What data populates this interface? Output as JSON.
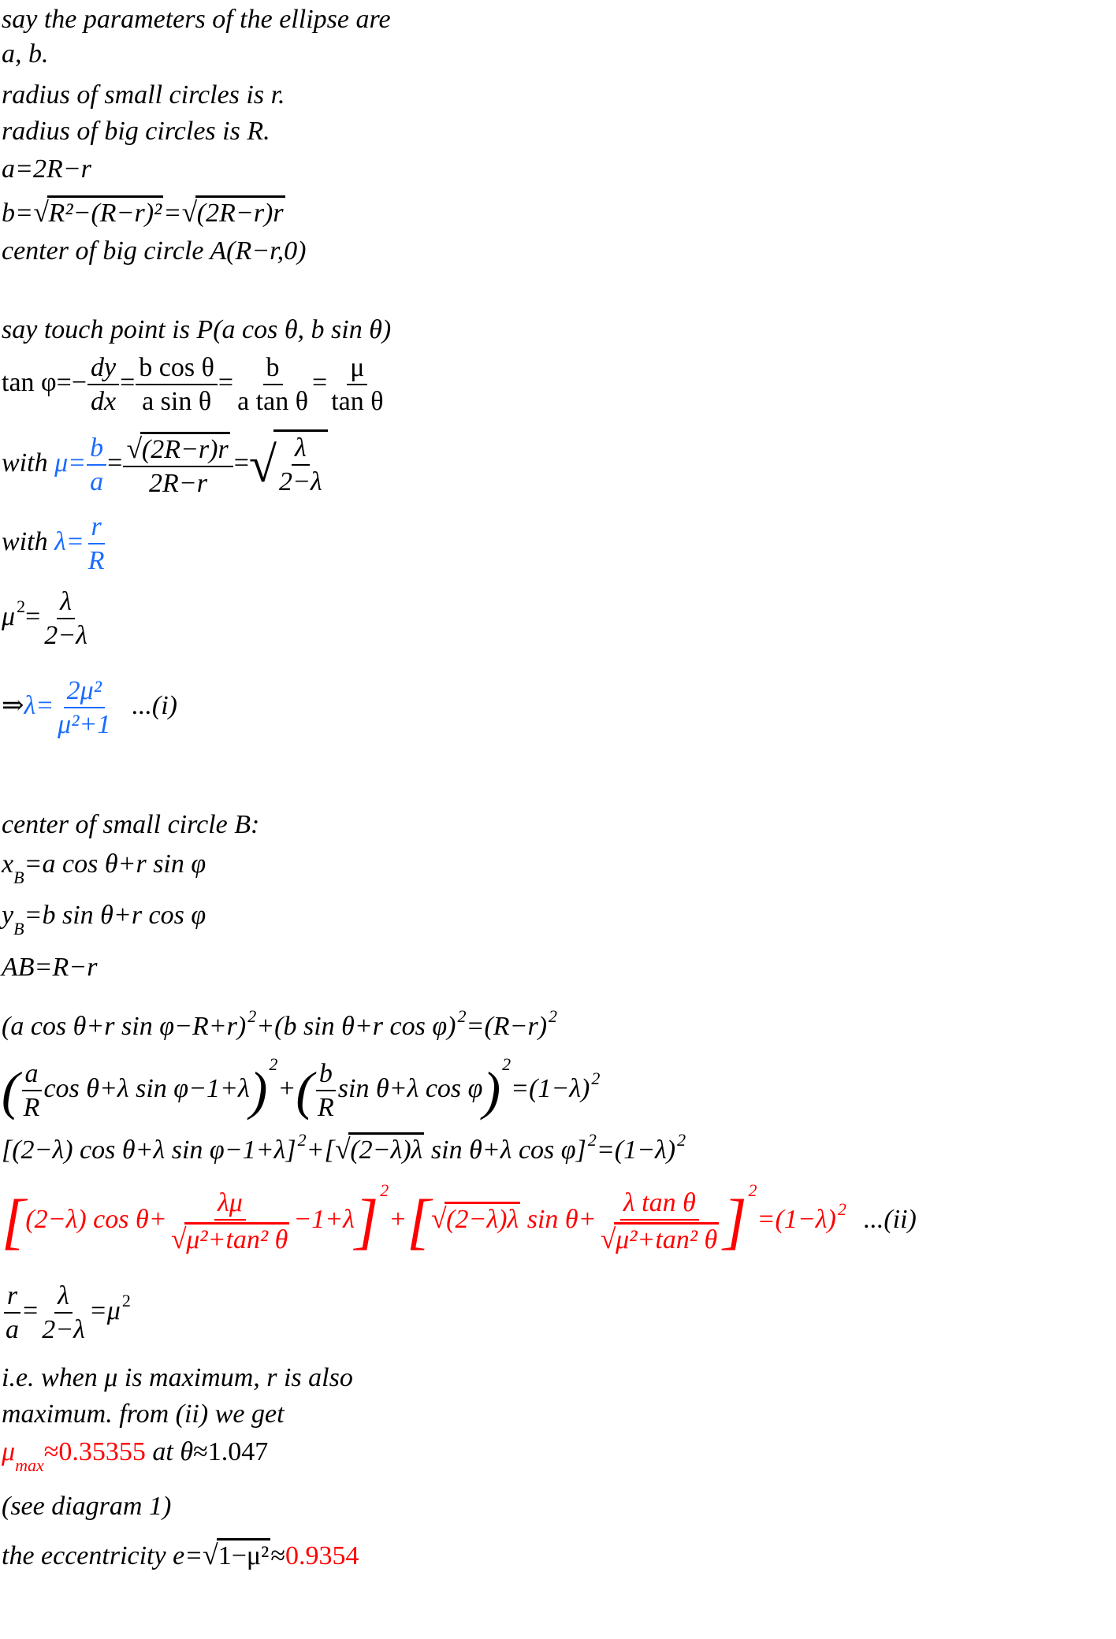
{
  "colors": {
    "text": "#000000",
    "highlight_blue": "#1a6cff",
    "highlight_red": "#ff0000",
    "background": "#ffffff"
  },
  "lines": {
    "l1": "say the parameters of the ellipse are",
    "l2": "a, b.",
    "l3": "radius of small circles is r.",
    "l4": "radius of big circles is R.",
    "l5": "a=2R−r",
    "l6": {
      "lhs": "b=",
      "rad1": "R²−(R−r)²",
      "eq": "=",
      "rad2": "(2R−r)r"
    },
    "l7": "center of big circle A(R−r,0)",
    "l8": "say touch point is P(a cos θ, b sin θ)",
    "l9": {
      "lhs": "tan φ=−",
      "f1n": "dy",
      "f1d": "dx",
      "f2n": "b cos θ",
      "f2d": "a sin θ",
      "f3n": "b",
      "f3d": "a tan θ",
      "f4n": "μ",
      "f4d": "tan θ"
    },
    "l10": {
      "prefix": "with ",
      "mu_eq": "μ=",
      "f1n": "b",
      "f1d": "a",
      "f2n": "(2R−r)r",
      "f2d": "2R−r",
      "f3n": "λ",
      "f3d": "2−λ"
    },
    "l11": {
      "prefix": "with ",
      "lam_eq": "λ=",
      "fn": "r",
      "fd": "R"
    },
    "l12": {
      "lhs": "μ",
      "exp": "2",
      "eq": "=",
      "fn": "λ",
      "fd": "2−λ"
    },
    "l13": {
      "arrow": "⇒",
      "lam_eq": "λ=",
      "fn": "2μ²",
      "fd": "μ²+1",
      "tag": "...(i)"
    },
    "l14": "center of small circle B:",
    "l15": {
      "var": "x",
      "sub": "B",
      "rhs": "=a cos θ+r sin φ"
    },
    "l16": {
      "var": "y",
      "sub": "B",
      "rhs": "=b sin θ+r cos φ"
    },
    "l17": "AB=R−r",
    "l18": {
      "t1": "(a cos θ+r sin φ−R+r)",
      "t2": "+(b sin θ+r cos φ)",
      "t3": "=(R−r)",
      "exp": "2"
    },
    "l19": {
      "f1n": "a",
      "f1d": "R",
      "t1": "cos θ+λ sin φ−1+λ",
      "plus": "+",
      "f2n": "b",
      "f2d": "R",
      "t2": "sin θ+λ cos φ",
      "rhs": "=(1−λ)",
      "exp": "2"
    },
    "l20": {
      "t1": "[(2−λ) cos θ+λ sin φ−1+λ]",
      "t2": "+[",
      "rad": "(2−λ)λ",
      "t3": " sin θ+λ cos φ]",
      "rhs": "=(1−λ)",
      "exp": "2"
    },
    "l21": {
      "t1": "(2−λ) cos θ+",
      "f1n": "λμ",
      "f1d": "μ²+tan² θ",
      "t2": "−1+λ",
      "plus": "+",
      "rad": "(2−λ)λ",
      "t3": " sin θ+",
      "f2n": "λ tan θ",
      "f2d": "μ²+tan² θ",
      "rhs": "=(1−λ)",
      "exp": "2",
      "tag": "...(ii)"
    },
    "l22": {
      "f1n": "r",
      "f1d": "a",
      "eq1": "=",
      "f2n": "λ",
      "f2d": "2−λ",
      "eq2": "=μ",
      "exp": "2"
    },
    "l23": "i.e. when μ is maximum, r is also",
    "l24": "maximum. from (ii) we get",
    "l25": {
      "mu": "μ",
      "sub": "max",
      "val": "≈0.35355",
      "mid": " at θ",
      "theta_val": "≈1.047"
    },
    "l26": "(see diagram 1)",
    "l27": {
      "prefix": "the eccentricity e=",
      "rad": "1−μ²",
      "approx": "≈",
      "val": "0.9354"
    }
  }
}
